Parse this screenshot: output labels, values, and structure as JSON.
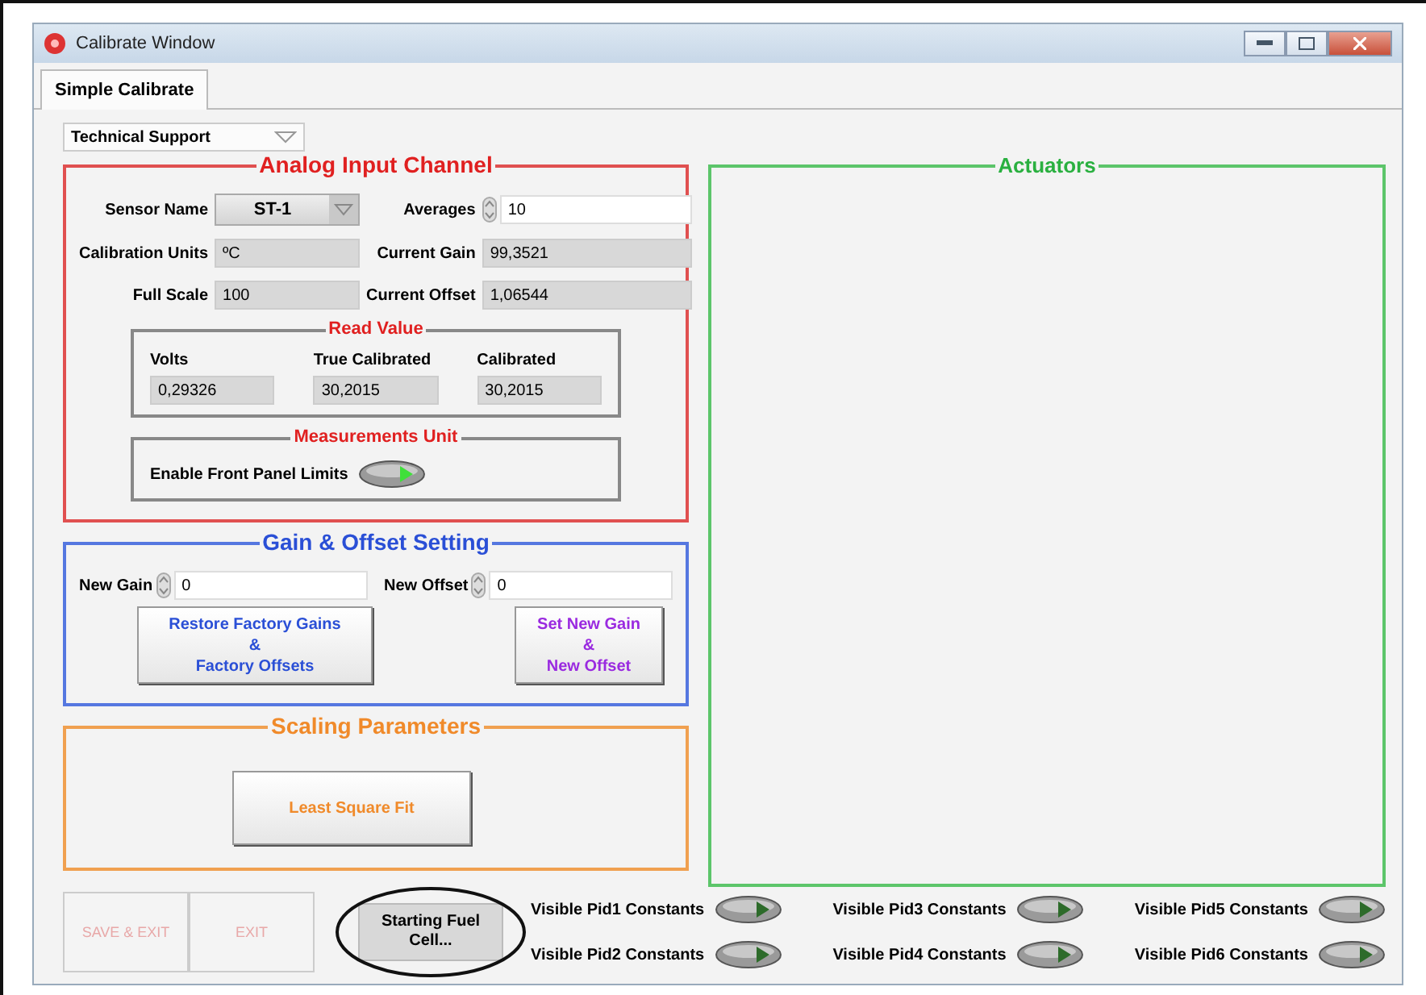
{
  "window": {
    "title": "Calibrate Window"
  },
  "tabs": [
    {
      "label": "Simple Calibrate",
      "selected": true
    }
  ],
  "mode_dropdown": {
    "value": "Technical Support"
  },
  "analog_input": {
    "title": "Analog Input Channel",
    "sensor_name": {
      "label": "Sensor Name",
      "value": "ST-1"
    },
    "averages": {
      "label": "Averages",
      "value": "10"
    },
    "calibration_units": {
      "label": "Calibration Units",
      "value": "ºC"
    },
    "current_gain": {
      "label": "Current Gain",
      "value": "99,3521"
    },
    "full_scale": {
      "label": "Full Scale",
      "value": "100"
    },
    "current_offset": {
      "label": "Current Offset",
      "value": "1,06544"
    },
    "read_value": {
      "title": "Read Value",
      "fields": [
        {
          "label": "Volts",
          "value": "0,29326"
        },
        {
          "label": "True Calibrated",
          "value": "30,2015"
        },
        {
          "label": "Calibrated",
          "value": "30,2015"
        }
      ]
    },
    "measurements_unit": {
      "title": "Measurements Unit",
      "toggle": {
        "label": "Enable Front Panel Limits",
        "on": true
      }
    }
  },
  "gain_offset": {
    "title": "Gain & Offset Setting",
    "new_gain": {
      "label": "New Gain",
      "value": "0"
    },
    "new_offset": {
      "label": "New Offset",
      "value": "0"
    },
    "buttons": [
      {
        "lines": [
          "Restore  Factory Gains",
          "&",
          "Factory Offsets"
        ],
        "color": "#2a4fd6"
      },
      {
        "lines": [
          "Set  New Gain",
          "&",
          "New Offset"
        ],
        "color": "#9a2ae0"
      }
    ]
  },
  "scaling": {
    "title": "Scaling Parameters",
    "button": "Least Square Fit"
  },
  "actuators": {
    "title": "Actuators"
  },
  "bottom_buttons": [
    {
      "label": "SAVE & EXIT",
      "disabled": true
    },
    {
      "label": "EXIT",
      "disabled": true
    }
  ],
  "start_button": {
    "lines": [
      "Starting Fuel",
      "Cell..."
    ],
    "circled": true
  },
  "pid_toggles": [
    {
      "label": "Visible Pid1 Constants",
      "on": false
    },
    {
      "label": "Visible Pid3 Constants",
      "on": false
    },
    {
      "label": "Visible Pid5 Constants",
      "on": false
    },
    {
      "label": "Visible Pid2 Constants",
      "on": false
    },
    {
      "label": "Visible Pid4 Constants",
      "on": false
    },
    {
      "label": "Visible Pid6 Constants",
      "on": false
    }
  ]
}
